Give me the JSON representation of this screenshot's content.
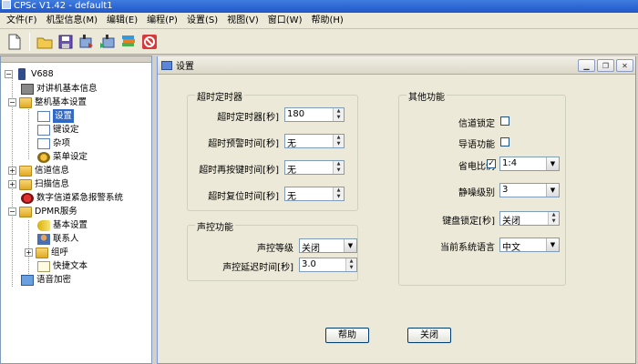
{
  "window": {
    "title": "CPSc V1.42 - default1"
  },
  "menu": [
    "文件(F)",
    "机型信息(M)",
    "编辑(E)",
    "编程(P)",
    "设置(S)",
    "视图(V)",
    "窗口(W)",
    "帮助(H)"
  ],
  "toolbar": {
    "icons": [
      "new-icon",
      "open-folder-icon",
      "save-icon",
      "read-radio-icon",
      "write-radio-icon",
      "stack-icon",
      "stop-icon"
    ]
  },
  "tree": {
    "root": "V688",
    "items": [
      {
        "label": "对讲机基本信息"
      },
      {
        "label": "整机基本设置"
      },
      {
        "label": "设置"
      },
      {
        "label": "键设定"
      },
      {
        "label": "杂项"
      },
      {
        "label": "菜单设定"
      },
      {
        "label": "信道信息"
      },
      {
        "label": "扫描信息"
      },
      {
        "label": "数字信道紧急报警系统"
      },
      {
        "label": "DPMR服务"
      },
      {
        "label": "基本设置"
      },
      {
        "label": "联系人"
      },
      {
        "label": "组呼"
      },
      {
        "label": "快捷文本"
      },
      {
        "label": "语音加密"
      }
    ]
  },
  "child": {
    "title": "设置",
    "timer_group": {
      "title": "超时定时器",
      "rows": [
        {
          "label": "超时定时器[秒]",
          "value": "180"
        },
        {
          "label": "超时预警时间[秒]",
          "value": "无"
        },
        {
          "label": "超时再按键时间[秒]",
          "value": "无"
        },
        {
          "label": "超时复位时间[秒]",
          "value": "无"
        }
      ]
    },
    "voice_group": {
      "title": "声控功能",
      "rows": [
        {
          "label": "声控等级",
          "value": "关闭"
        },
        {
          "label": "声控延迟时间[秒]",
          "value": "3.0"
        }
      ]
    },
    "other_group": {
      "title": "其他功能",
      "channel_lock": "信道锁定",
      "voice_prompt": "导语功能",
      "power_save": "省电比例",
      "power_save_value": "1:4",
      "squelch": "静噪级别",
      "squelch_value": "3",
      "keypad_lock": "键盘锁定[秒]",
      "keypad_lock_value": "关闭",
      "language": "当前系统语言",
      "language_value": "中文",
      "power_save_checked": "✓"
    },
    "buttons": {
      "help": "帮助",
      "close": "关闭"
    }
  }
}
